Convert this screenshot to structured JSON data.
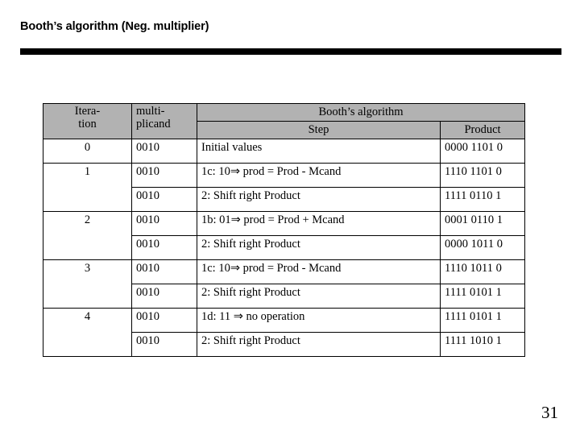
{
  "slide": {
    "title": "Booth’s algorithm (Neg. multiplier)",
    "page_number": "31"
  },
  "table": {
    "headers": {
      "iteration_line1": "Itera-",
      "iteration_line2": "tion",
      "multiplicand_line1": "multi-",
      "multiplicand_line2": "plicand",
      "group": "Booth’s algorithm",
      "step": "Step",
      "product": "Product"
    },
    "header_fill": "#b2b2b2",
    "rows": [
      {
        "iteration": "0",
        "iteration_span": 1,
        "iteration_align": "center",
        "multiplicand": "0010",
        "step": "Initial values",
        "product": "0000 1101 0"
      },
      {
        "iteration": "1",
        "iteration_span": 2,
        "iteration_align": "middle",
        "multiplicand": "0010",
        "step": "1c: 10⇒ prod = Prod - Mcand",
        "product": "1110 1101 0"
      },
      {
        "iteration": "",
        "iteration_span": 0,
        "multiplicand": "0010",
        "step": "2: Shift right Product",
        "product": "1111 0110 1"
      },
      {
        "iteration": "2",
        "iteration_span": 2,
        "iteration_align": "top",
        "multiplicand": "0010",
        "step": "1b: 01⇒ prod = Prod + Mcand",
        "product": "0001 0110 1"
      },
      {
        "iteration": "",
        "iteration_span": 0,
        "multiplicand": "0010",
        "step": "2: Shift right Product",
        "product": "0000 1011 0"
      },
      {
        "iteration": "3",
        "iteration_span": 2,
        "iteration_align": "top",
        "multiplicand": "0010",
        "step": "1c: 10⇒ prod = Prod - Mcand",
        "product": "1110 1011 0"
      },
      {
        "iteration": "",
        "iteration_span": 0,
        "multiplicand": "0010",
        "step": "2: Shift right Product",
        "product": "1111 0101 1"
      },
      {
        "iteration": "4",
        "iteration_span": 2,
        "iteration_align": "top",
        "multiplicand": "0010",
        "step": "1d: 11 ⇒ no operation",
        "product": "1111 0101 1"
      },
      {
        "iteration": "",
        "iteration_span": 0,
        "multiplicand": "0010",
        "step": "2: Shift right Product",
        "product": "1111 1010 1"
      }
    ]
  }
}
